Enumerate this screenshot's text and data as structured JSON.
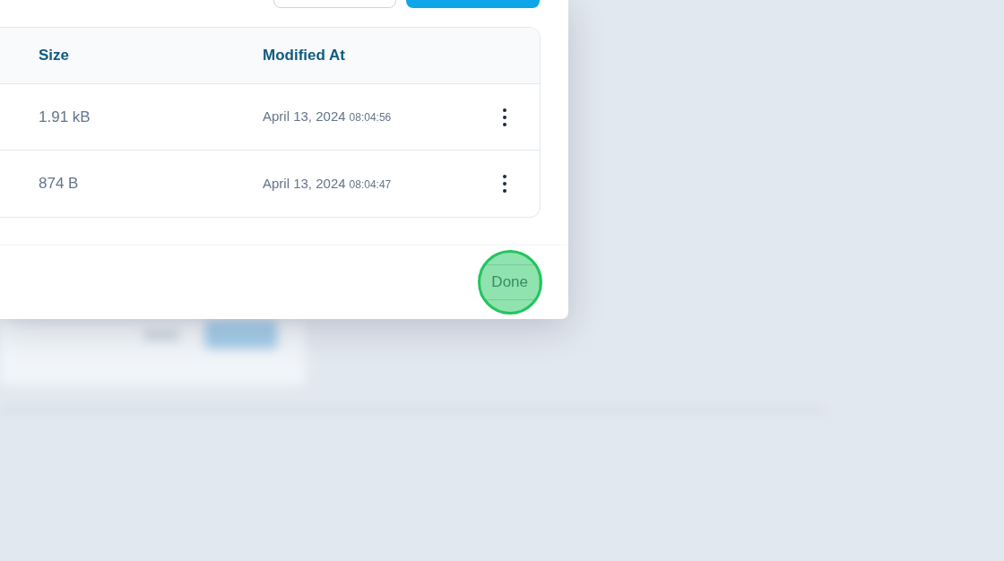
{
  "table": {
    "columns": [
      "Size",
      "Modified At"
    ],
    "rows": [
      {
        "size": "1.91 kB",
        "date": "April 13, 2024",
        "time": "08:04:56"
      },
      {
        "size": "874 B",
        "date": "April 13, 2024",
        "time": "08:04:47"
      }
    ]
  },
  "footer": {
    "button": "Done"
  }
}
